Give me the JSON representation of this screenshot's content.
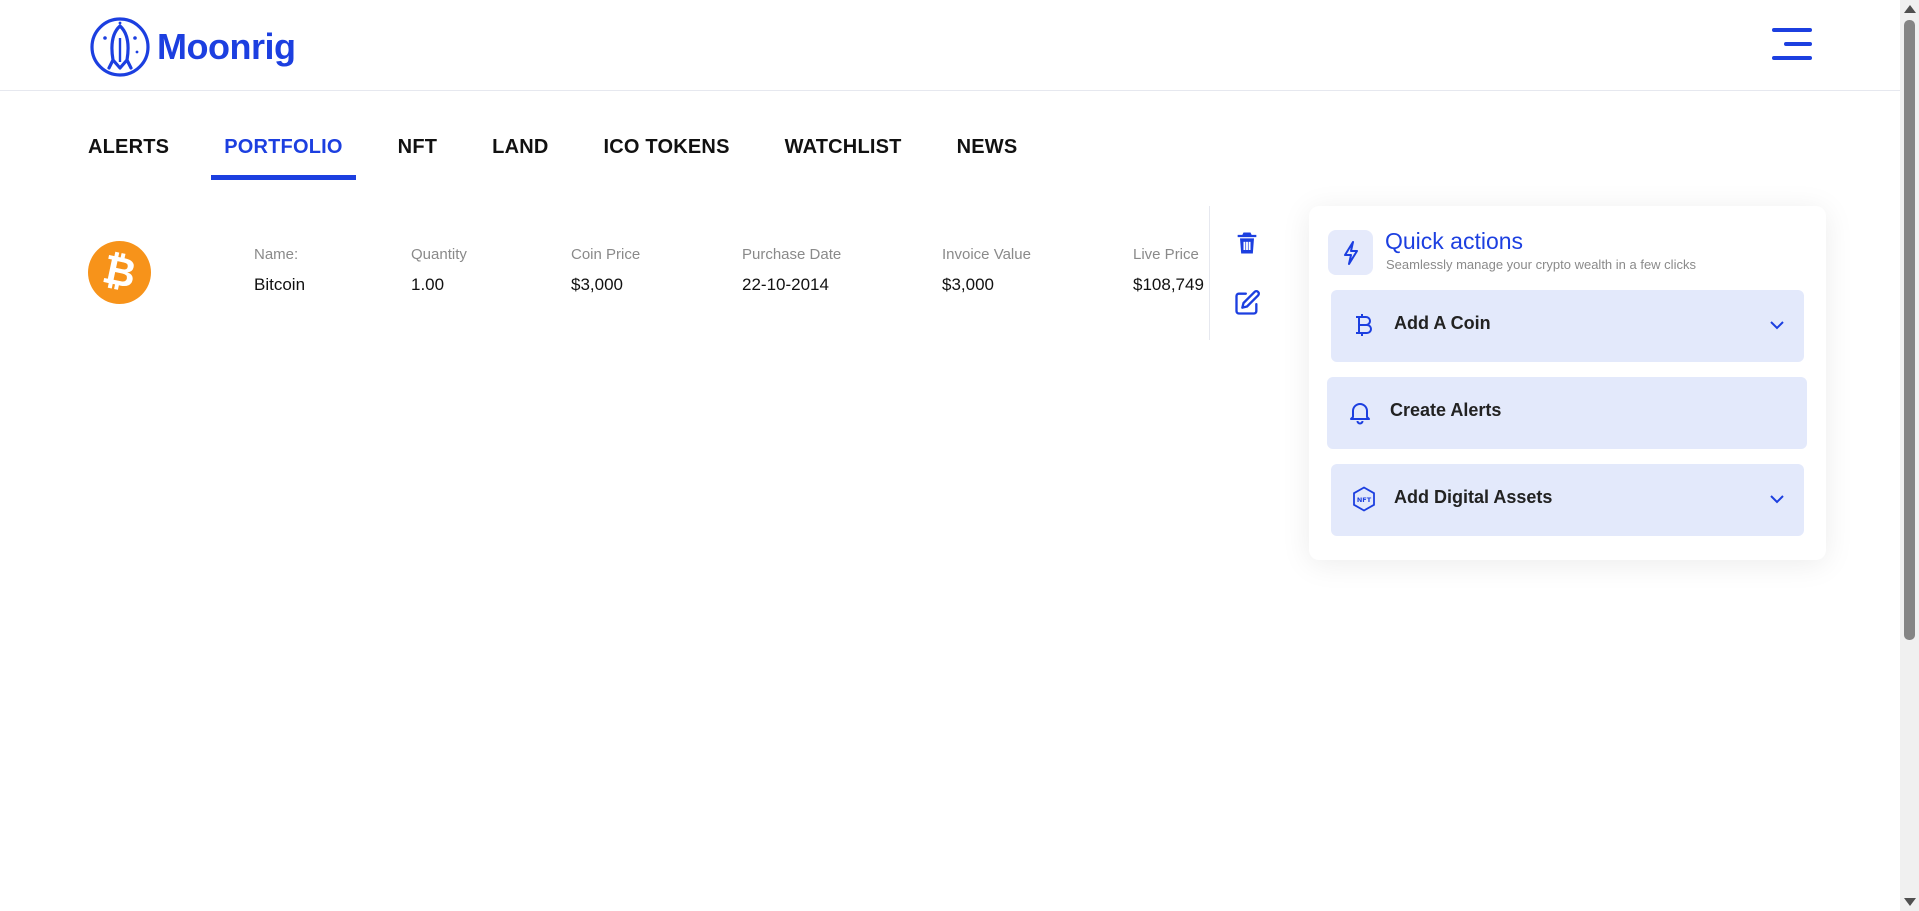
{
  "brand": {
    "name": "Moonrig",
    "color": "#1c3fe0"
  },
  "header": {
    "menu_icon": "hamburger-menu-icon"
  },
  "tabs": [
    {
      "label": "ALERTS",
      "active": false
    },
    {
      "label": "PORTFOLIO",
      "active": true
    },
    {
      "label": "NFT",
      "active": false
    },
    {
      "label": "LAND",
      "active": false
    },
    {
      "label": "ICO TOKENS",
      "active": false
    },
    {
      "label": "WATCHLIST",
      "active": false
    },
    {
      "label": "NEWS",
      "active": false
    }
  ],
  "portfolio": {
    "coin_icon": "bitcoin-icon",
    "coin_symbol": "₿",
    "coin_color": "#f7931a",
    "fields": [
      {
        "label": "Name:",
        "value": "Bitcoin"
      },
      {
        "label": "Quantity",
        "value": "1.00"
      },
      {
        "label": "Coin Price",
        "value": "$3,000"
      },
      {
        "label": "Purchase Date",
        "value": "22-10-2014"
      },
      {
        "label": "Invoice Value",
        "value": "$3,000"
      },
      {
        "label": "Live Price",
        "value": "$108,749"
      }
    ],
    "actions": [
      "trash-icon",
      "edit-icon"
    ]
  },
  "quick_actions": {
    "title": "Quick actions",
    "subtitle": "Seamlessly manage your crypto wealth in a few clicks",
    "items": [
      {
        "label": "Add A Coin",
        "icon": "bitcoin-outline-icon",
        "expandable": true
      },
      {
        "label": "Create Alerts",
        "icon": "bell-icon",
        "expandable": false
      },
      {
        "label": "Add Digital Assets",
        "icon": "nft-hexagon-icon",
        "expandable": true
      }
    ]
  }
}
